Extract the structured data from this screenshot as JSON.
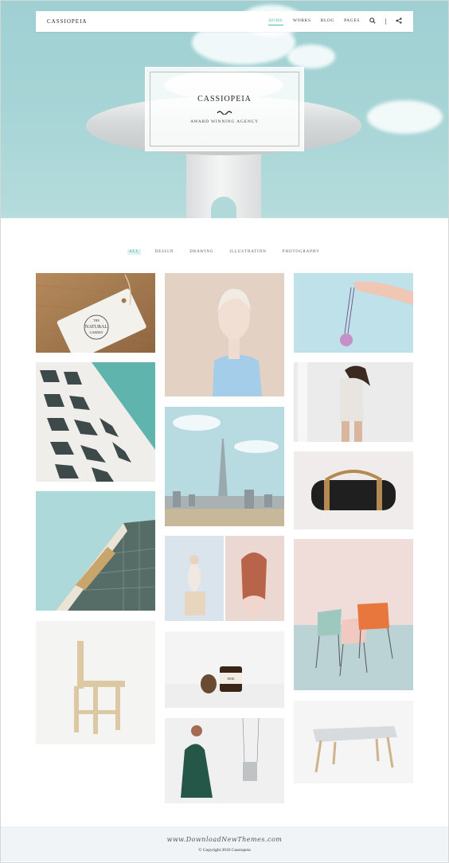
{
  "header": {
    "brand": "CASSIOPEIA",
    "nav": [
      "HOME",
      "WORKS",
      "BLOG",
      "PAGES"
    ],
    "active_nav": "HOME",
    "icons": [
      "search-icon",
      "share-icon"
    ]
  },
  "hero": {
    "title": "CASSIOPEIA",
    "subtitle": "AWARD WINNING AGENCY"
  },
  "filters": {
    "items": [
      "ALL",
      "DESIGN",
      "DRAWING",
      "ILLUSTRATION",
      "PHOTOGRAPHY"
    ],
    "active": "ALL"
  },
  "portfolio": {
    "items": [
      {
        "subject": "natural-garden-tag",
        "text": [
          "THE",
          "NATURAL",
          "GARDEN"
        ]
      },
      {
        "subject": "woman-portrait"
      },
      {
        "subject": "hand-holding-ornament"
      },
      {
        "subject": "building-facade"
      },
      {
        "subject": "woman-tshirt"
      },
      {
        "subject": "city-skyline"
      },
      {
        "subject": "duffel-bag"
      },
      {
        "subject": "building-corner"
      },
      {
        "subject": "figures-diptych"
      },
      {
        "subject": "chairs"
      },
      {
        "subject": "wooden-chair"
      },
      {
        "subject": "pinecone-jar",
        "text": [
          "PINE"
        ]
      },
      {
        "subject": "desk"
      },
      {
        "subject": "woman-green-coat"
      }
    ]
  },
  "footer": {
    "watermark": "www.DownloadNewThemes.com",
    "copyright": "© Copyright 2016 Cassiopeia"
  },
  "colors": {
    "accent": "#4bbfb5",
    "hero_sky": "#a8d5d6",
    "footer_bg": "#f1f4f6"
  }
}
